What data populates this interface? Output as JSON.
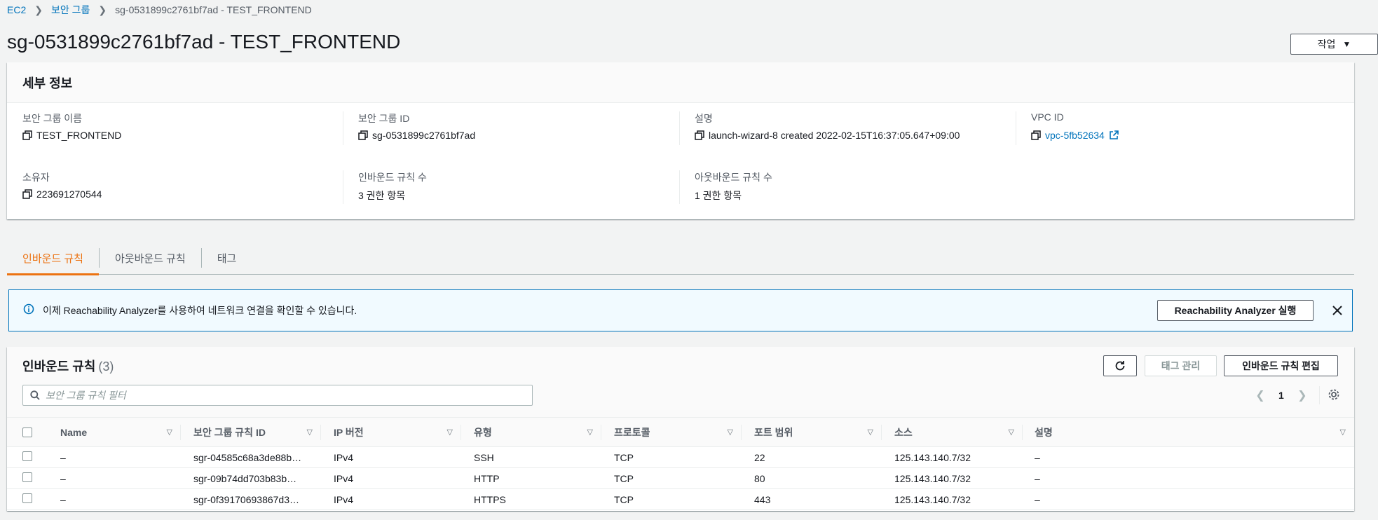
{
  "breadcrumb": {
    "items": [
      "EC2",
      "보안 그룹"
    ],
    "current": "sg-0531899c2761bf7ad - TEST_FRONTEND"
  },
  "page": {
    "title": "sg-0531899c2761bf7ad - TEST_FRONTEND",
    "actions_label": "작업"
  },
  "details": {
    "header": "세부 정보",
    "group_name_label": "보안 그룹 이름",
    "group_name": "TEST_FRONTEND",
    "group_id_label": "보안 그룹 ID",
    "group_id": "sg-0531899c2761bf7ad",
    "description_label": "설명",
    "description": "launch-wizard-8 created 2022-02-15T16:37:05.647+09:00",
    "vpc_label": "VPC ID",
    "vpc_id": "vpc-5fb52634",
    "owner_label": "소유자",
    "owner": "223691270544",
    "inbound_count_label": "인바운드 규칙 수",
    "inbound_count": "3 권한 항목",
    "outbound_count_label": "아웃바운드 규칙 수",
    "outbound_count": "1 권한 항목"
  },
  "tabs": [
    "인바운드 규칙",
    "아웃바운드 규칙",
    "태그"
  ],
  "alert": {
    "message": "이제 Reachability Analyzer를 사용하여 네트워크 연결을 확인할 수 있습니다.",
    "button": "Reachability Analyzer 실행"
  },
  "rules": {
    "title": "인바운드 규칙",
    "count": "(3)",
    "tag_button": "태그 관리",
    "edit_button": "인바운드 규칙 편집",
    "filter_placeholder": "보안 그룹 규칙 필터",
    "page": "1",
    "columns": [
      "Name",
      "보안 그룹 규칙 ID",
      "IP 버전",
      "유형",
      "프로토콜",
      "포트 범위",
      "소스",
      "설명"
    ],
    "rows": [
      [
        "–",
        "sgr-04585c68a3de88b…",
        "IPv4",
        "SSH",
        "TCP",
        "22",
        "125.143.140.7/32",
        "–"
      ],
      [
        "–",
        "sgr-09b74dd703b83b…",
        "IPv4",
        "HTTP",
        "TCP",
        "80",
        "125.143.140.7/32",
        "–"
      ],
      [
        "–",
        "sgr-0f39170693867d3…",
        "IPv4",
        "HTTPS",
        "TCP",
        "443",
        "125.143.140.7/32",
        "–"
      ]
    ]
  },
  "colors": {
    "link": "#0073bb",
    "accent_tab": "#ec7211",
    "info_bg": "#f1faff",
    "info_border": "#0073bb"
  }
}
